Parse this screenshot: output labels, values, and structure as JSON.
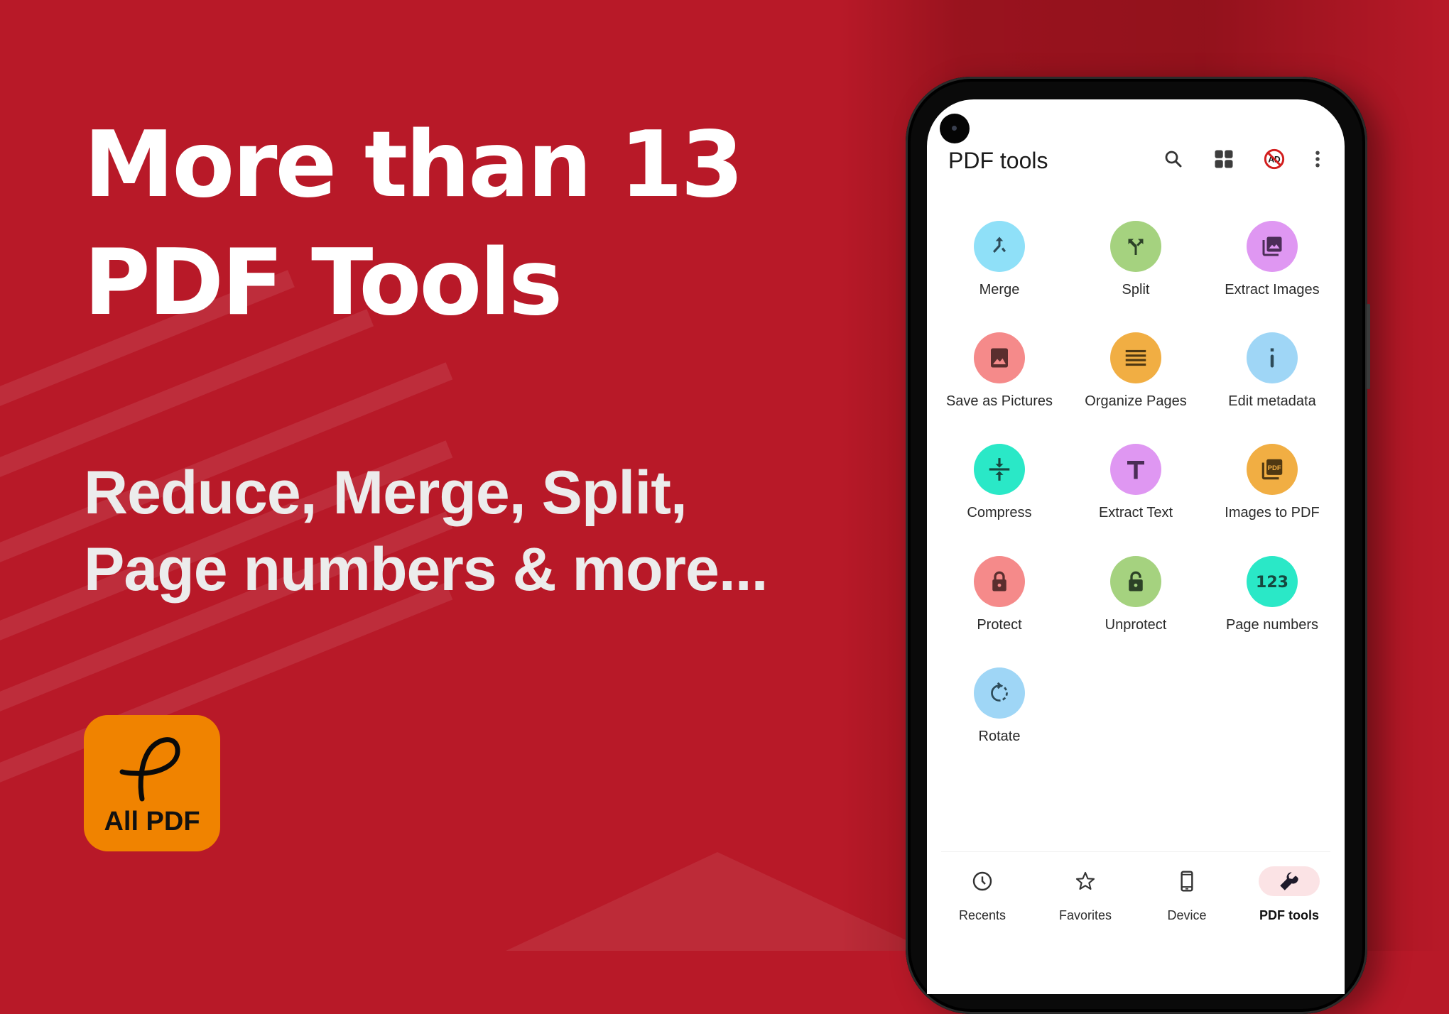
{
  "promo": {
    "headline_line1": "More than 13",
    "headline_line2": "PDF Tools",
    "subhead_line1": "Reduce, Merge, Split,",
    "subhead_line2": "Page numbers & more...",
    "background_color": "#b81928",
    "app_logo": {
      "label": "All PDF",
      "icon": "script-p-logo",
      "color": "#f08300"
    }
  },
  "app": {
    "title": "PDF tools",
    "toolbar": [
      {
        "icon": "search-icon",
        "label": "Search"
      },
      {
        "icon": "grid-view-icon",
        "label": "Grid view"
      },
      {
        "icon": "no-ads-icon",
        "label": "Remove ads"
      },
      {
        "icon": "more-vert-icon",
        "label": "More options"
      }
    ],
    "tools": [
      {
        "label": "Merge",
        "icon": "merge-icon",
        "color": "#8fe0f8",
        "fg": "#2d4b59"
      },
      {
        "label": "Split",
        "icon": "split-icon",
        "color": "#a5d27f",
        "fg": "#2c4127"
      },
      {
        "label": "Extract Images",
        "icon": "extract-images-icon",
        "color": "#df97f2",
        "fg": "#4b2d57"
      },
      {
        "label": "Save as Pictures",
        "icon": "image-icon",
        "color": "#f58a8a",
        "fg": "#5a2e2e"
      },
      {
        "label": "Organize Pages",
        "icon": "list-lines-icon",
        "color": "#f1ae43",
        "fg": "#4f3812"
      },
      {
        "label": "Edit metadata",
        "icon": "info-icon",
        "color": "#9fd6f6",
        "fg": "#2d4b59"
      },
      {
        "label": "Compress",
        "icon": "compress-icon",
        "color": "#2ae8c7",
        "fg": "#16483f"
      },
      {
        "label": "Extract Text",
        "icon": "text-t-icon",
        "color": "#df97f2",
        "fg": "#4b2d57"
      },
      {
        "label": "Images to PDF",
        "icon": "images-to-pdf-icon",
        "color": "#f1ae43",
        "fg": "#4f3812"
      },
      {
        "label": "Protect",
        "icon": "lock-icon",
        "color": "#f58a8a",
        "fg": "#5a2e2e"
      },
      {
        "label": "Unprotect",
        "icon": "unlock-icon",
        "color": "#a5d27f",
        "fg": "#2c4127"
      },
      {
        "label": "Page numbers",
        "icon": "numbers-123-icon",
        "color": "#2ae8c7",
        "fg": "#16483f"
      },
      {
        "label": "Rotate",
        "icon": "rotate-icon",
        "color": "#9fd6f6",
        "fg": "#2d4b59"
      }
    ],
    "bottom_nav": [
      {
        "label": "Recents",
        "icon": "clock-icon",
        "active": false
      },
      {
        "label": "Favorites",
        "icon": "star-icon",
        "active": false
      },
      {
        "label": "Device",
        "icon": "phone-device-icon",
        "active": false
      },
      {
        "label": "PDF tools",
        "icon": "wrench-icon",
        "active": true
      }
    ],
    "active_nav_color": "#fbe3e5"
  }
}
